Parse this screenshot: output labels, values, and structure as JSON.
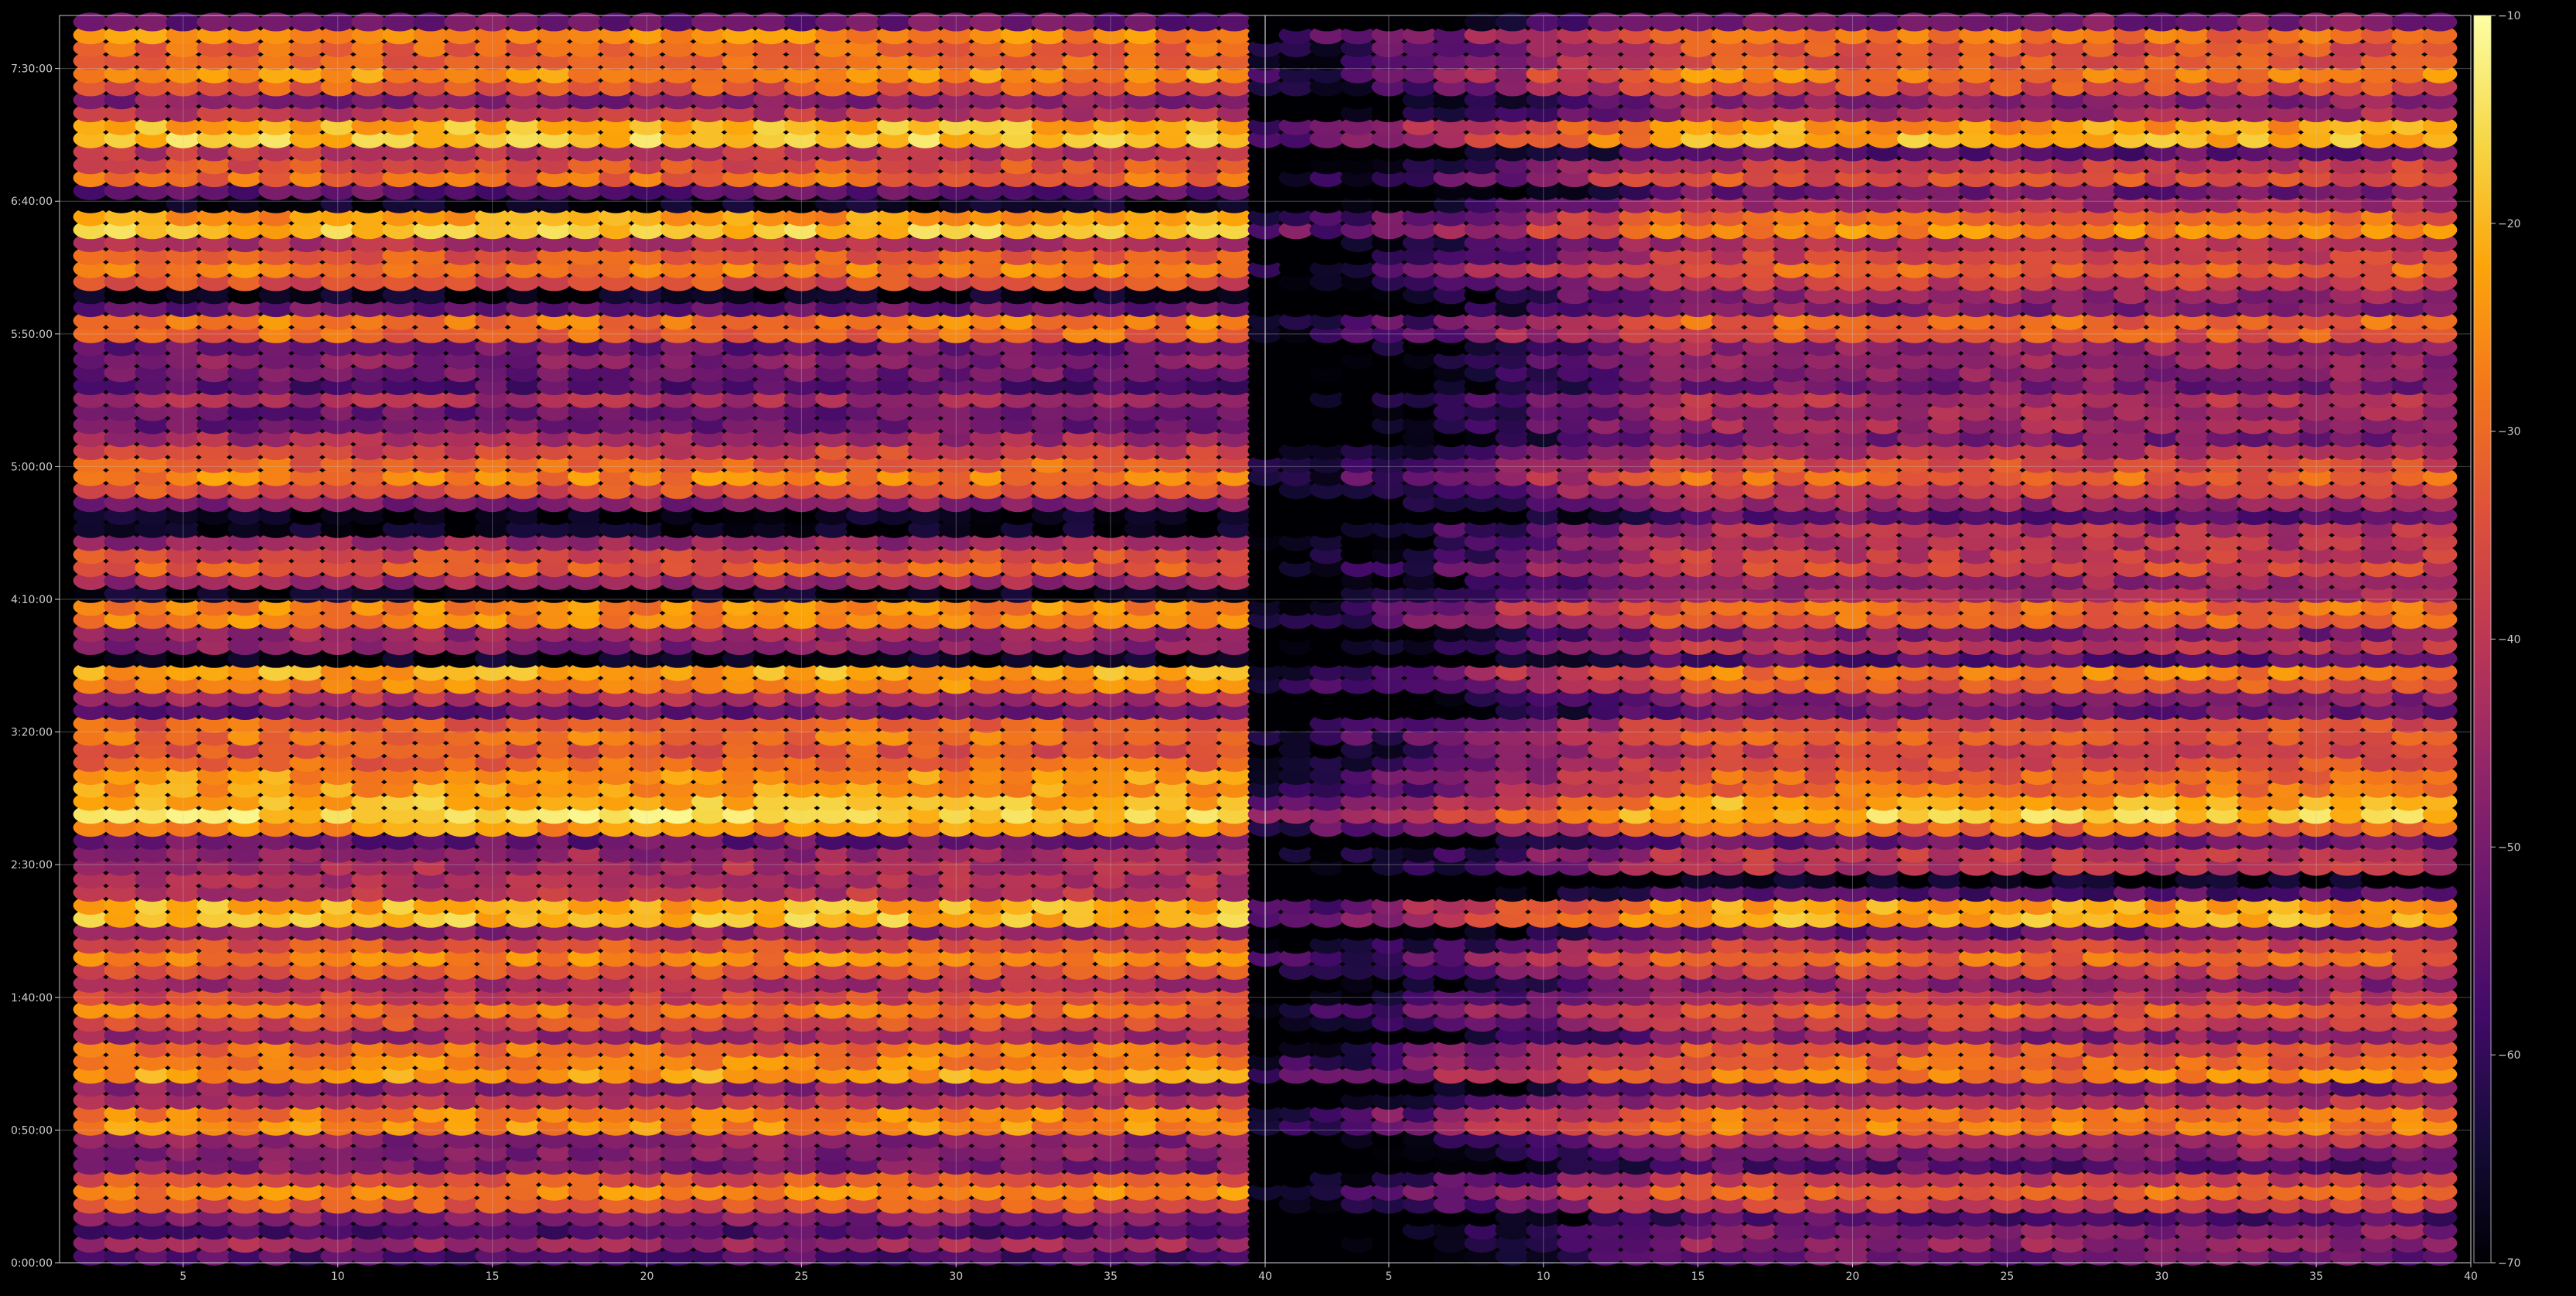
{
  "chart_data": {
    "type": "heatmap",
    "colormap": "inferno",
    "background": "#000000",
    "foreground": "#cccccc",
    "grid": true,
    "colorbar": {
      "placement": "right",
      "range": [
        -70,
        -10
      ],
      "ticks": [
        -70,
        -60,
        -50,
        -40,
        -30,
        -20,
        -10
      ],
      "tick_labels": [
        "−70",
        "−60",
        "−50",
        "−40",
        "−30",
        "−20",
        "−10"
      ]
    },
    "y_axis": {
      "range_seconds": [
        0,
        28200
      ],
      "ticks_seconds": [
        0,
        3000,
        6000,
        9000,
        12000,
        15000,
        18000,
        21000,
        24000,
        27000
      ],
      "tick_labels": [
        "0:00:00",
        "0:50:00",
        "1:40:00",
        "2:30:00",
        "3:20:00",
        "4:10:00",
        "5:00:00",
        "5:50:00",
        "6:40:00",
        "7:30:00"
      ]
    },
    "panels": [
      {
        "name": "",
        "x_range": [
          1,
          40
        ],
        "x_ticks": [
          5,
          10,
          15,
          20,
          25,
          30,
          35,
          40
        ],
        "x_tick_labels": [
          "5",
          "10",
          "15",
          "20",
          "25",
          "30",
          "35",
          "40"
        ],
        "cells_x": [
          2,
          39
        ],
        "intensity_profile": "uniform",
        "bright_rows": [
          {
            "t": 25500,
            "value": -15
          },
          {
            "t": 23400,
            "value": -17
          },
          {
            "t": 10200,
            "value": -14
          },
          {
            "t": 10850,
            "value": -20
          },
          {
            "t": 9900,
            "value": -22
          },
          {
            "t": 7900,
            "value": -16
          },
          {
            "t": 3200,
            "value": -22
          },
          {
            "t": 4300,
            "value": -22
          },
          {
            "t": 4650,
            "value": -24
          },
          {
            "t": 12000,
            "value": -26
          },
          {
            "t": 14700,
            "value": -22
          },
          {
            "t": 13300,
            "value": -20
          },
          {
            "t": 17800,
            "value": -26
          },
          {
            "t": 26900,
            "value": -24
          },
          {
            "t": 27700,
            "value": -24
          },
          {
            "t": 22500,
            "value": -26
          },
          {
            "t": 21200,
            "value": -25
          },
          {
            "t": 24600,
            "value": -28
          },
          {
            "t": 1600,
            "value": -26
          },
          {
            "t": 5700,
            "value": -28
          },
          {
            "t": 6900,
            "value": -26
          },
          {
            "t": 15800,
            "value": -30
          },
          {
            "t": 18100,
            "value": -30
          },
          {
            "t": 11400,
            "value": -28
          }
        ]
      },
      {
        "name": "",
        "x_range": [
          1,
          40
        ],
        "x_ticks": [
          5,
          10,
          15,
          20,
          25,
          30,
          35,
          40
        ],
        "x_tick_labels": [
          "5",
          "10",
          "15",
          "20",
          "25",
          "30",
          "35",
          "40"
        ],
        "cells_x": [
          1,
          39
        ],
        "intensity_profile": "ramp-up-left",
        "bright_rows": [
          {
            "t": 25500,
            "value": -18
          },
          {
            "t": 23400,
            "value": -24
          },
          {
            "t": 10200,
            "value": -16
          },
          {
            "t": 10850,
            "value": -26
          },
          {
            "t": 9900,
            "value": -28
          },
          {
            "t": 7900,
            "value": -18
          },
          {
            "t": 3200,
            "value": -24
          },
          {
            "t": 4300,
            "value": -26
          },
          {
            "t": 4650,
            "value": -28
          },
          {
            "t": 12000,
            "value": -30
          },
          {
            "t": 14700,
            "value": -26
          },
          {
            "t": 13300,
            "value": -26
          },
          {
            "t": 17800,
            "value": -30
          },
          {
            "t": 26900,
            "value": -26
          },
          {
            "t": 27700,
            "value": -28
          },
          {
            "t": 22500,
            "value": -30
          },
          {
            "t": 21200,
            "value": -28
          },
          {
            "t": 24600,
            "value": -32
          },
          {
            "t": 1600,
            "value": -30
          },
          {
            "t": 5700,
            "value": -32
          },
          {
            "t": 6900,
            "value": -30
          },
          {
            "t": 15800,
            "value": -34
          },
          {
            "t": 18100,
            "value": -34
          },
          {
            "t": 11400,
            "value": -32
          }
        ]
      }
    ]
  }
}
